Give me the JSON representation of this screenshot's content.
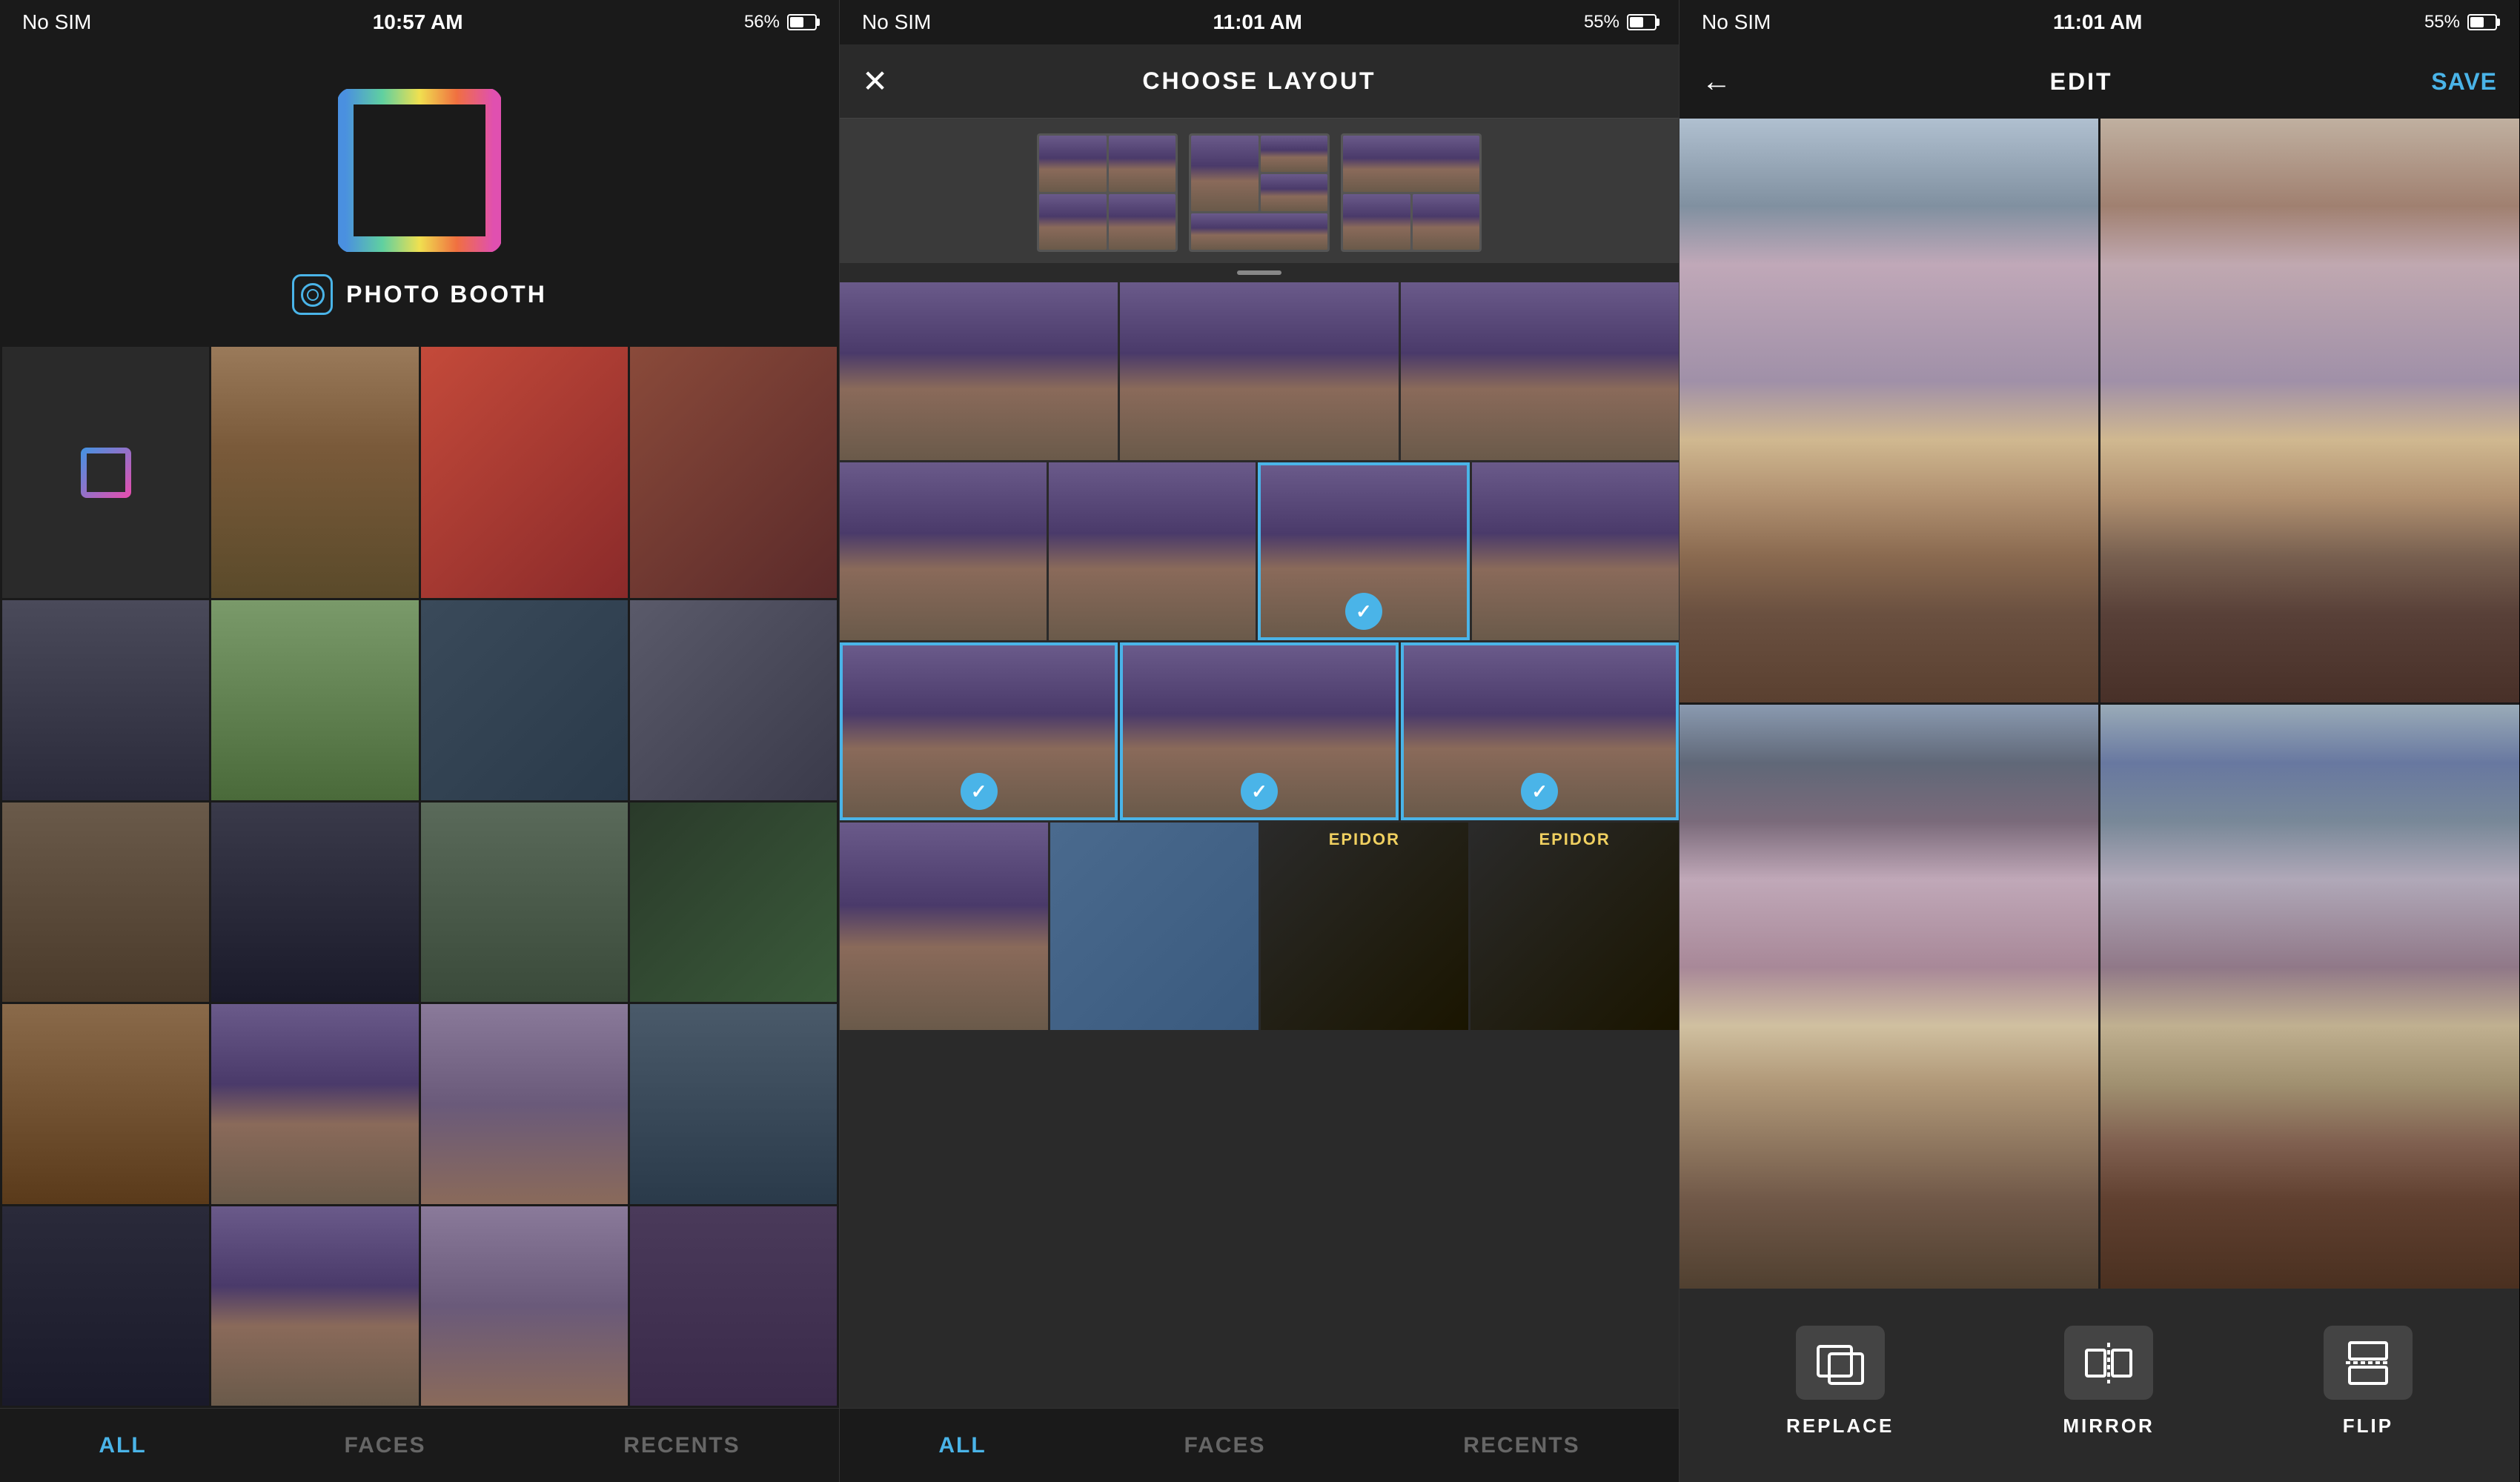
{
  "panels": [
    {
      "id": "photobooth",
      "statusBar": {
        "left": "No SIM",
        "center": "10:57 AM",
        "right": "56%"
      },
      "logo": {
        "alt": "Layout logo gradient square"
      },
      "photoboothLabel": "PHOTO BOOTH",
      "photoGrid": {
        "rows": 4,
        "cols": 4
      },
      "tabs": [
        {
          "label": "ALL",
          "active": true
        },
        {
          "label": "FACES",
          "active": false
        },
        {
          "label": "RECENTS",
          "active": false
        }
      ]
    },
    {
      "id": "chooselayout",
      "statusBar": {
        "left": "No SIM",
        "center": "11:01 AM",
        "right": "55%"
      },
      "header": {
        "closeLabel": "✕",
        "title": "CHOOSE LAYOUT"
      },
      "tabs": [
        {
          "label": "ALL",
          "active": true
        },
        {
          "label": "FACES",
          "active": false
        },
        {
          "label": "RECENTS",
          "active": false
        }
      ]
    },
    {
      "id": "edit",
      "statusBar": {
        "left": "No SIM",
        "center": "11:01 AM",
        "right": "55%"
      },
      "header": {
        "backLabel": "←",
        "title": "EDIT",
        "saveLabel": "SAVE"
      },
      "tools": [
        {
          "id": "replace",
          "label": "REPLACE"
        },
        {
          "id": "mirror",
          "label": "MIRROR"
        },
        {
          "id": "flip",
          "label": "FLIP"
        }
      ]
    }
  ]
}
